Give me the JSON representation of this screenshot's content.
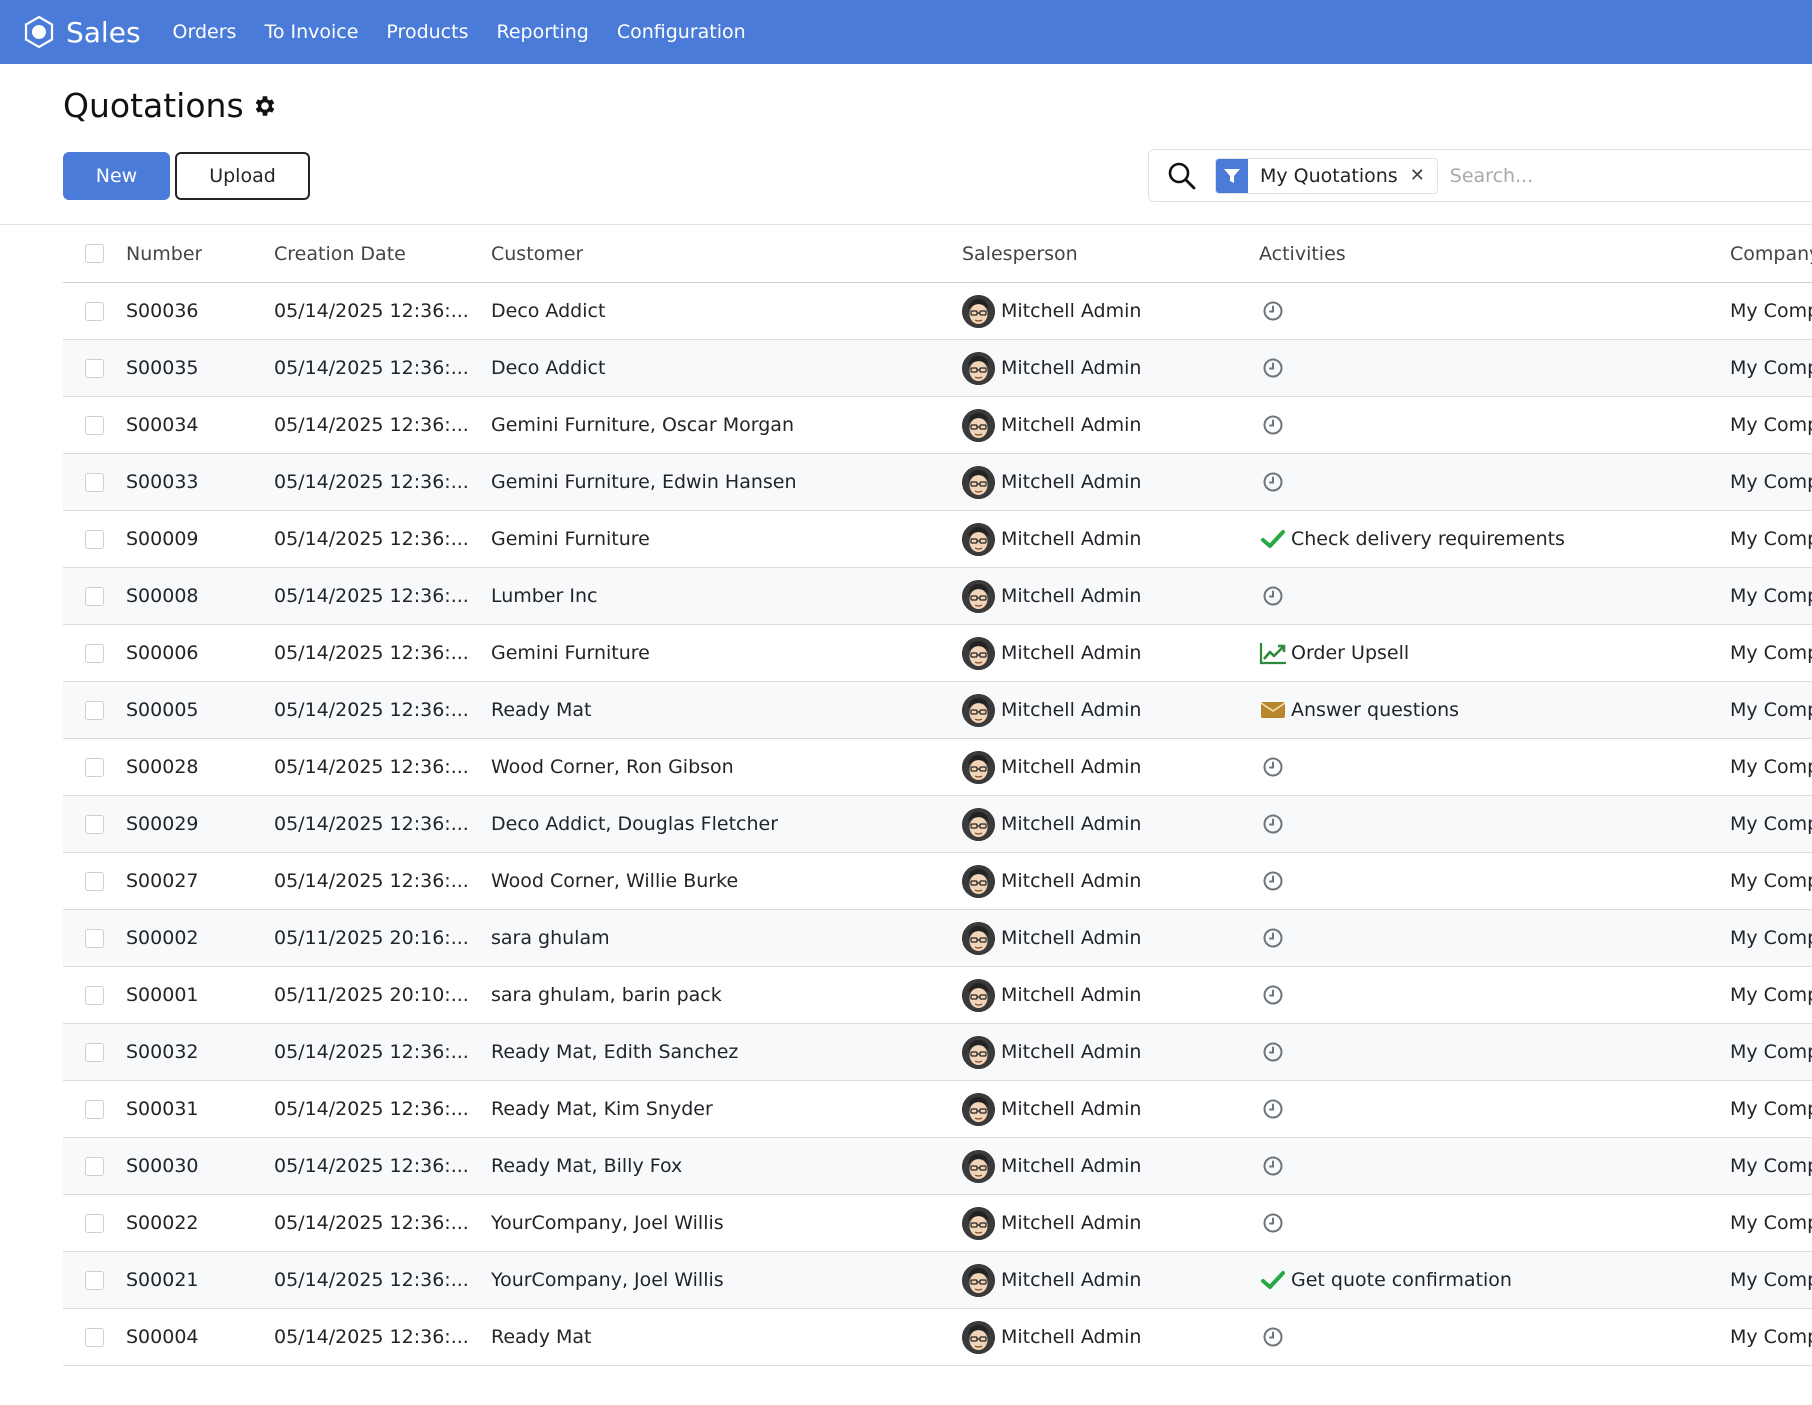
{
  "nav": {
    "app_name": "Sales",
    "items": [
      "Orders",
      "To Invoice",
      "Products",
      "Reporting",
      "Configuration"
    ]
  },
  "page": {
    "title": "Quotations",
    "new_label": "New",
    "upload_label": "Upload"
  },
  "search": {
    "facet": "My Quotations",
    "facet_close": "✕",
    "placeholder": "Search..."
  },
  "table": {
    "headers": {
      "number": "Number",
      "creation_date": "Creation Date",
      "customer": "Customer",
      "salesperson": "Salesperson",
      "activities": "Activities",
      "company": "Company"
    },
    "rows": [
      {
        "number": "S00036",
        "date": "05/14/2025 12:36:...",
        "customer": "Deco Addict",
        "salesperson": "Mitchell Admin",
        "activity_icon": "clock-icon",
        "activity": "",
        "company": "My Comp"
      },
      {
        "number": "S00035",
        "date": "05/14/2025 12:36:...",
        "customer": "Deco Addict",
        "salesperson": "Mitchell Admin",
        "activity_icon": "clock-icon",
        "activity": "",
        "company": "My Comp"
      },
      {
        "number": "S00034",
        "date": "05/14/2025 12:36:...",
        "customer": "Gemini Furniture, Oscar Morgan",
        "salesperson": "Mitchell Admin",
        "activity_icon": "clock-icon",
        "activity": "",
        "company": "My Comp"
      },
      {
        "number": "S00033",
        "date": "05/14/2025 12:36:...",
        "customer": "Gemini Furniture, Edwin Hansen",
        "salesperson": "Mitchell Admin",
        "activity_icon": "clock-icon",
        "activity": "",
        "company": "My Comp"
      },
      {
        "number": "S00009",
        "date": "05/14/2025 12:36:...",
        "customer": "Gemini Furniture",
        "salesperson": "Mitchell Admin",
        "activity_icon": "check-icon",
        "activity": "Check delivery requirements",
        "company": "My Comp"
      },
      {
        "number": "S00008",
        "date": "05/14/2025 12:36:...",
        "customer": "Lumber Inc",
        "salesperson": "Mitchell Admin",
        "activity_icon": "clock-icon",
        "activity": "",
        "company": "My Comp"
      },
      {
        "number": "S00006",
        "date": "05/14/2025 12:36:...",
        "customer": "Gemini Furniture",
        "salesperson": "Mitchell Admin",
        "activity_icon": "chart-line-icon",
        "activity": "Order Upsell",
        "company": "My Comp"
      },
      {
        "number": "S00005",
        "date": "05/14/2025 12:36:...",
        "customer": "Ready Mat",
        "salesperson": "Mitchell Admin",
        "activity_icon": "envelope-icon",
        "activity": "Answer questions",
        "company": "My Comp"
      },
      {
        "number": "S00028",
        "date": "05/14/2025 12:36:...",
        "customer": "Wood Corner, Ron Gibson",
        "salesperson": "Mitchell Admin",
        "activity_icon": "clock-icon",
        "activity": "",
        "company": "My Comp"
      },
      {
        "number": "S00029",
        "date": "05/14/2025 12:36:...",
        "customer": "Deco Addict, Douglas Fletcher",
        "salesperson": "Mitchell Admin",
        "activity_icon": "clock-icon",
        "activity": "",
        "company": "My Comp"
      },
      {
        "number": "S00027",
        "date": "05/14/2025 12:36:...",
        "customer": "Wood Corner, Willie Burke",
        "salesperson": "Mitchell Admin",
        "activity_icon": "clock-icon",
        "activity": "",
        "company": "My Comp"
      },
      {
        "number": "S00002",
        "date": "05/11/2025 20:16:...",
        "customer": "sara ghulam",
        "salesperson": "Mitchell Admin",
        "activity_icon": "clock-icon",
        "activity": "",
        "company": "My Comp"
      },
      {
        "number": "S00001",
        "date": "05/11/2025 20:10:...",
        "customer": "sara ghulam, barin pack",
        "salesperson": "Mitchell Admin",
        "activity_icon": "clock-icon",
        "activity": "",
        "company": "My Comp"
      },
      {
        "number": "S00032",
        "date": "05/14/2025 12:36:...",
        "customer": "Ready Mat, Edith Sanchez",
        "salesperson": "Mitchell Admin",
        "activity_icon": "clock-icon",
        "activity": "",
        "company": "My Comp"
      },
      {
        "number": "S00031",
        "date": "05/14/2025 12:36:...",
        "customer": "Ready Mat, Kim Snyder",
        "salesperson": "Mitchell Admin",
        "activity_icon": "clock-icon",
        "activity": "",
        "company": "My Comp"
      },
      {
        "number": "S00030",
        "date": "05/14/2025 12:36:...",
        "customer": "Ready Mat, Billy Fox",
        "salesperson": "Mitchell Admin",
        "activity_icon": "clock-icon",
        "activity": "",
        "company": "My Comp"
      },
      {
        "number": "S00022",
        "date": "05/14/2025 12:36:...",
        "customer": "YourCompany, Joel Willis",
        "salesperson": "Mitchell Admin",
        "activity_icon": "clock-icon",
        "activity": "",
        "company": "My Comp"
      },
      {
        "number": "S00021",
        "date": "05/14/2025 12:36:...",
        "customer": "YourCompany, Joel Willis",
        "salesperson": "Mitchell Admin",
        "activity_icon": "check-icon",
        "activity": "Get quote confirmation",
        "company": "My Comp"
      },
      {
        "number": "S00004",
        "date": "05/14/2025 12:36:...",
        "customer": "Ready Mat",
        "salesperson": "Mitchell Admin",
        "activity_icon": "clock-icon",
        "activity": "",
        "company": "My Comp"
      }
    ]
  },
  "colors": {
    "brand": "#4a7bd9",
    "check": "#28a745",
    "upsell": "#2e8b3a",
    "envelope": "#b8862b",
    "clock": "#6c757d"
  }
}
